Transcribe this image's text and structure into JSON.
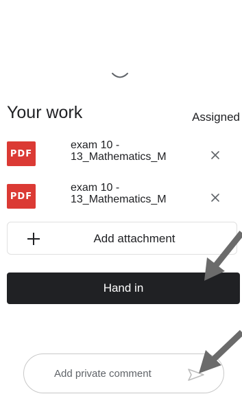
{
  "sheet": {
    "title": "Your work",
    "status": "Assigned"
  },
  "attachments": [
    {
      "type": "PDF",
      "name": "exam 10 -\n13_Mathematics_M"
    },
    {
      "type": "PDF",
      "name": "exam 10 -\n13_Mathematics_M"
    }
  ],
  "actions": {
    "add_attachment": "Add attachment",
    "hand_in": "Hand in"
  },
  "comment": {
    "placeholder": "Add private comment"
  },
  "colors": {
    "pdf_red": "#db3a34",
    "hand_in_bg": "#202124",
    "annotation_arrow": "#6b6b6b"
  }
}
